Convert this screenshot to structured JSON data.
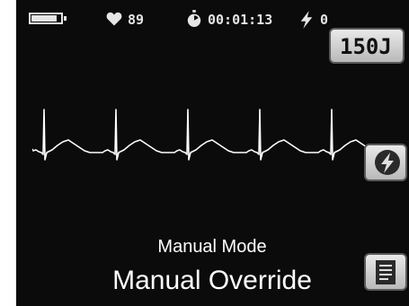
{
  "status_bar": {
    "battery_level": 0.88,
    "heart_icon": "heart-icon",
    "heart_rate": "89",
    "timer_icon": "stopwatch-icon",
    "elapsed_time": "00:01:13",
    "shock_icon": "lightning-bolt-icon",
    "shock_count": "0"
  },
  "controls": {
    "energy_label": "150J",
    "shock_icon": "shock-lightning-icon",
    "menu_icon": "document-menu-icon"
  },
  "main": {
    "mode": "Manual Mode",
    "override": "Manual Override"
  },
  "colors": {
    "background": "#0b0b0b",
    "trace": "#ffffff",
    "button": "#d8d8d8"
  }
}
